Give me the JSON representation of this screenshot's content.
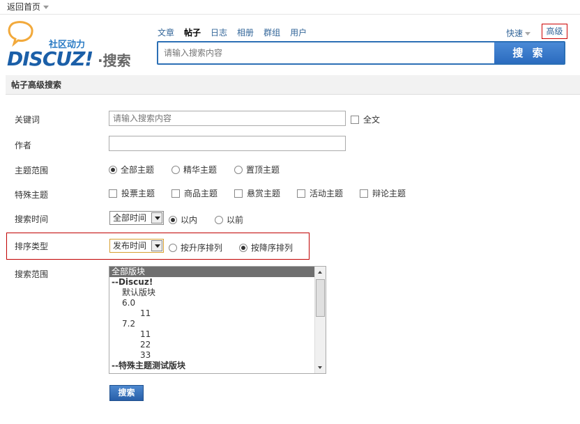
{
  "topbar": {
    "back_home": "返回首页"
  },
  "header": {
    "logo_tagline": "社区动力",
    "logo_brand": "DISCUZ!",
    "logo_suffix": "·搜索",
    "scope_tabs": [
      {
        "label": "文章",
        "active": false
      },
      {
        "label": "帖子",
        "active": true
      },
      {
        "label": "日志",
        "active": false
      },
      {
        "label": "相册",
        "active": false
      },
      {
        "label": "群组",
        "active": false
      },
      {
        "label": "用户",
        "active": false
      }
    ],
    "quick_label": "快速",
    "advanced_label": "高级",
    "search_placeholder": "请输入搜索内容",
    "search_button": "搜 索"
  },
  "form": {
    "title": "帖子高级搜索",
    "keyword": {
      "label": "关键词",
      "placeholder": "请输入搜索内容",
      "fulltext_label": "全文"
    },
    "author": {
      "label": "作者",
      "value": ""
    },
    "topic_scope": {
      "label": "主题范围",
      "options": [
        "全部主题",
        "精华主题",
        "置顶主题"
      ],
      "selected": "全部主题"
    },
    "special_topics": {
      "label": "特殊主题",
      "options": [
        "投票主题",
        "商品主题",
        "悬赏主题",
        "活动主题",
        "辩论主题"
      ]
    },
    "search_time": {
      "label": "搜索时间",
      "select_value": "全部时间",
      "options": [
        "以内",
        "以前"
      ],
      "selected": "以内"
    },
    "sort_type": {
      "label": "排序类型",
      "select_value": "发布时间",
      "options": [
        "按升序排列",
        "按降序排列"
      ],
      "selected": "按降序排列"
    },
    "search_scope": {
      "label": "搜索范围",
      "items": [
        {
          "text": "全部版块",
          "level": "sel"
        },
        {
          "text": "--Discuz!",
          "level": "group"
        },
        {
          "text": "默认版块",
          "level": "l1"
        },
        {
          "text": "6.0",
          "level": "l1"
        },
        {
          "text": "11",
          "level": "l2"
        },
        {
          "text": "7.2",
          "level": "l1"
        },
        {
          "text": "11",
          "level": "l2"
        },
        {
          "text": "22",
          "level": "l2"
        },
        {
          "text": "33",
          "level": "l2"
        },
        {
          "text": "--特殊主题测试版块",
          "level": "group"
        }
      ]
    },
    "submit_label": "搜索"
  },
  "colors": {
    "accent": "#2b6fb5",
    "highlight_border": "#c00000",
    "link": "#336699"
  }
}
